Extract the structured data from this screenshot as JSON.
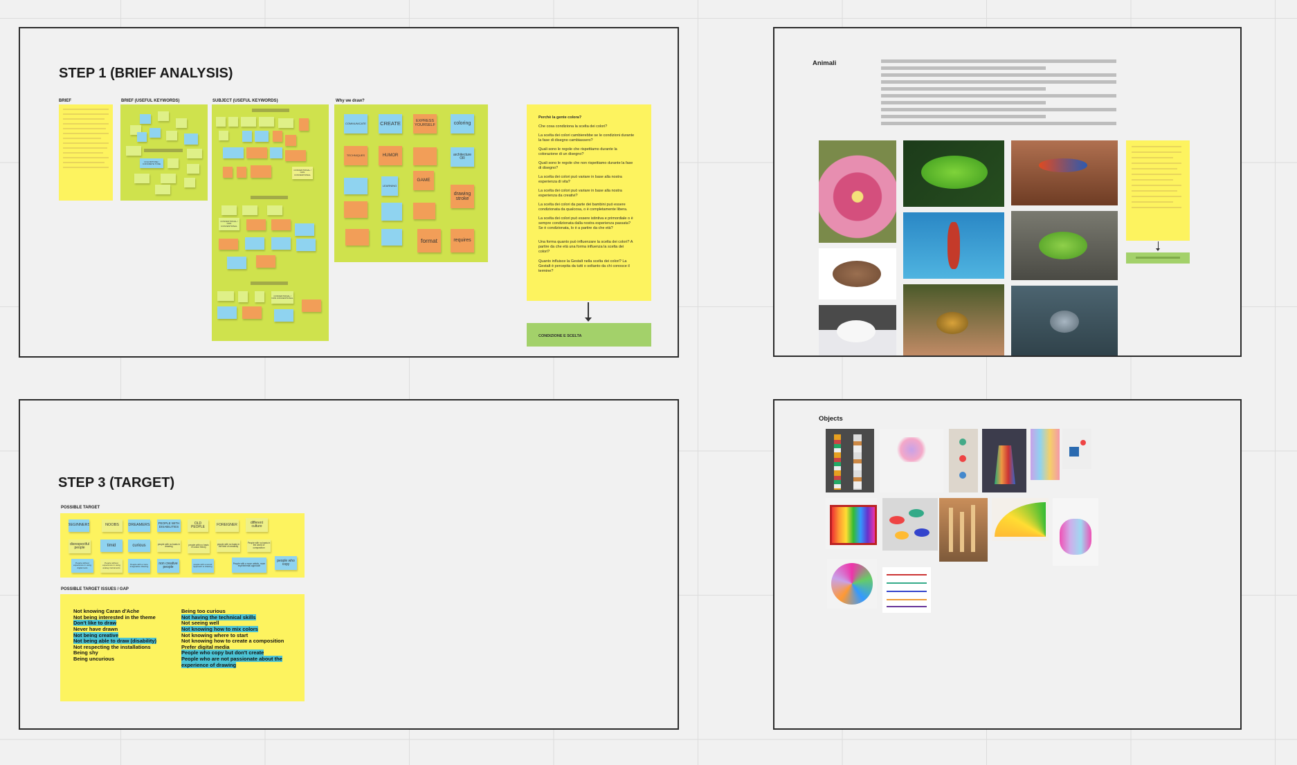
{
  "step1": {
    "title": "STEP 1 (BRIEF ANALYSIS)",
    "col_brief": "BRIEF",
    "col_brief_keywords": "BRIEF (USEFUL KEYWORDS)",
    "col_subject_keywords": "SUBJECT (USEFUL KEYWORDS)",
    "col_why": "Why we draw?",
    "why_notes": [
      "COMMUNICATE",
      "CREATE",
      "EXPRESS YOURSELF",
      "coloring",
      "TECHNIQUES",
      "HUMOR",
      "architecture OR",
      "GAME",
      "drawing stroke",
      "format",
      "requires",
      "LEARNING"
    ],
    "subject_notes": [
      "CONVENTIONAL / NON CONVENTIONAL",
      "CONVENTIONAL / NON CONVENTIONAL",
      "CONVENTIONAL / NON CONVENTIONAL"
    ],
    "brief_kw_note": "COLOR/TONE / CONCRETE TONE",
    "questions": {
      "heading": "Perchè la gente colora?",
      "items": [
        "Che cosa condiziona la scelta dei colori?",
        "La scelta dei colori cambierebbe se le condizioni durante la fase di disegno cambiassero?",
        "Quali sono le regole che rispettiamo durante la colorazione di un disegno?",
        "Quali sono le regole che non rispettiamo durante la fase di disegno?",
        "La scelta dei colori può variare in base alla nostra esperienza di vita?",
        "La scelta dei colori può variare in base alla nostra esperienza da creativi?",
        "La scelta dei colori da parte dei bambini può essere condizionata da qualcosa, o è completamente libera.",
        "La scelta dei colori può essere istintiva e primordiale o è sempre condizionata dalla nostra esperienza passata? Se è condizionata, lo è a partire da che età?",
        "Una forma quanto può influenzare la scelta dei colori? A partire da che età una forma influenza la scelta dei colori?",
        "Quanto influisce la Gestalt nella scelta dei colori? La Gestalt è percepita da tutti o soltanto da chi conosce il termine?"
      ]
    },
    "result": "CONDIZIONE E SCELTA"
  },
  "step3": {
    "title": "STEP 3 (TARGET)",
    "possible_target_label": "POSSIBLE TARGET",
    "targets_row1": [
      "BEGINNERS",
      "NOOBS",
      "DREAMERS",
      "PEOPLE WITH DISABILITIES",
      "OLD PEOPLE",
      "FOREIGNER",
      "different culture"
    ],
    "targets_row2": [
      "disrespectful people",
      "timid",
      "curious",
      "people with no basis in drawing",
      "people with no basis in colour theory",
      "people with no basis in the field of creativity",
      "People with no basis in the world of composition"
    ],
    "targets_row3": [
      "People without experience in using digital tools",
      "People without experience in using analog instruments",
      "People with a more imaginative drawing",
      "non creative people",
      "people with a sound approach to drawing",
      "People with a more artistic, more experimental approach",
      "people who copy"
    ],
    "issues_label": "POSSIBLE TARGET ISSUES / GAP",
    "issues_left": [
      {
        "text": "Not knowing Caran d'Ache",
        "hl": false
      },
      {
        "text": "Not being interested in the theme",
        "hl": false
      },
      {
        "text": "Don't like to draw",
        "hl": true
      },
      {
        "text": "Never have drawn",
        "hl": false
      },
      {
        "text": "Not being creative",
        "hl": true
      },
      {
        "text": "Not being able to draw (disability)",
        "hl": true
      },
      {
        "text": "Not respecting the installations",
        "hl": false
      },
      {
        "text": "Being shy",
        "hl": false
      },
      {
        "text": "Being uncurious",
        "hl": false
      }
    ],
    "issues_right": [
      {
        "text": "Being too curious",
        "hl": false
      },
      {
        "text": "Not having the technical skills",
        "hl": true
      },
      {
        "text": "Not seeing well",
        "hl": false
      },
      {
        "text": "Not knowing how to mix colors",
        "hl": true
      },
      {
        "text": "Not knowing where to start",
        "hl": false
      },
      {
        "text": "Not knowing how to create a composition",
        "hl": false
      },
      {
        "text": "Prefer digital media",
        "hl": false
      },
      {
        "text": "People who copy but don't create",
        "hl": true
      },
      {
        "text": "People who are not passionate about the",
        "hl": true
      },
      {
        "text": "experience of drawing",
        "hl": true
      }
    ]
  },
  "animali": {
    "title": "Animali"
  },
  "objects": {
    "title": "Objects"
  },
  "colors": {
    "canvas": "#f1f1f1",
    "sticky_yellow": "#fdf35f",
    "board_green": "#cfe24d",
    "note_blue": "#8fd3f0",
    "note_orange": "#f29e58",
    "result_green": "#a3d16a",
    "highlight_teal": "#4dc4d6"
  }
}
